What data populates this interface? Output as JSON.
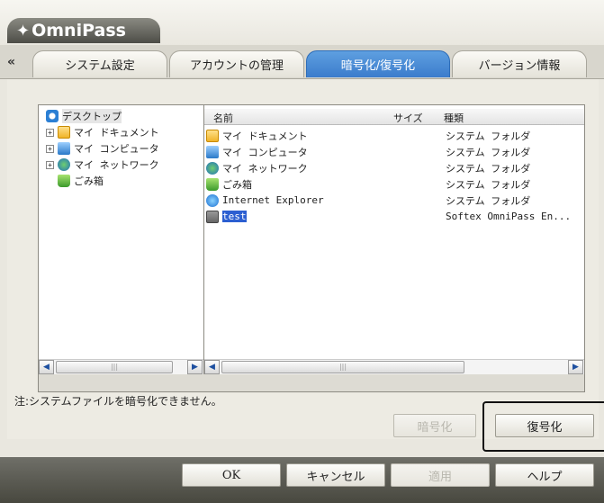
{
  "app": {
    "title": "OmniPass"
  },
  "tabs": {
    "scroll_left": "«",
    "items": [
      "システム設定",
      "アカウントの管理",
      "暗号化/復号化",
      "バージョン情報"
    ],
    "active_index": 2
  },
  "tree": {
    "items": [
      {
        "label": "デスクトップ",
        "icon": "desktop-icon"
      },
      {
        "label": "マイ ドキュメント",
        "icon": "folder-icon"
      },
      {
        "label": "マイ コンピュータ",
        "icon": "computer-icon"
      },
      {
        "label": "マイ ネットワーク",
        "icon": "network-icon"
      },
      {
        "label": "ごみ箱",
        "icon": "recycle-bin-icon"
      }
    ]
  },
  "list": {
    "columns": {
      "name": "名前",
      "size": "サイズ",
      "type": "種類"
    },
    "rows": [
      {
        "name": "マイ ドキュメント",
        "type": "システム フォルダ",
        "icon": "folder-icon"
      },
      {
        "name": "マイ コンピュータ",
        "type": "システム フォルダ",
        "icon": "computer-icon"
      },
      {
        "name": "マイ ネットワーク",
        "type": "システム フォルダ",
        "icon": "network-icon"
      },
      {
        "name": "ごみ箱",
        "type": "システム フォルダ",
        "icon": "recycle-bin-icon"
      },
      {
        "name": "Internet Explorer",
        "type": "システム フォルダ",
        "icon": "internet-explorer-icon"
      },
      {
        "name": "test",
        "type": "Softex OmniPass En...",
        "icon": "encrypted-folder-icon"
      }
    ],
    "selected_index": 5
  },
  "note": "注:システムファイルを暗号化できません。",
  "actions": {
    "encrypt": "暗号化",
    "decrypt": "復号化"
  },
  "footer": {
    "ok": "OK",
    "cancel": "キャンセル",
    "apply": "適用",
    "help": "ヘルプ"
  },
  "colors": {
    "accent": "#3b7ccc",
    "selection": "#2c5fd1"
  }
}
